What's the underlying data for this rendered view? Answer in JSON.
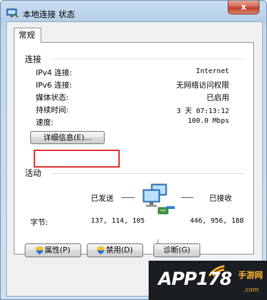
{
  "window": {
    "title": "本地连接 状态",
    "close_label": "x"
  },
  "tab": {
    "label": "常规"
  },
  "connection": {
    "heading": "连接",
    "rows": [
      {
        "label": "IPv4 连接:",
        "value": "Internet"
      },
      {
        "label": "IPv6 连接:",
        "value": "无网络访问权限"
      },
      {
        "label": "媒体状态:",
        "value": "已启用"
      },
      {
        "label": "持续时间:",
        "value": "3 天 07:13:12"
      },
      {
        "label": "速度:",
        "value": "100.0 Mbps"
      }
    ],
    "details_button": "详细信息(E)..."
  },
  "activity": {
    "heading": "活动",
    "sent_label": "已发送",
    "received_label": "已接收",
    "bytes_label": "字节:",
    "bytes_sent": "137, 114, 105",
    "bytes_received": "446, 956, 188"
  },
  "buttons": {
    "properties": "属性(P)",
    "disable": "禁用(D)",
    "diagnose": "诊断(G)"
  },
  "watermark": {
    "text": "APP178",
    "cn": "手游网",
    "com": ".com"
  },
  "colors": {
    "highlight": "#e02a2a",
    "titlebar": "#c9ddef",
    "close": "#c2402c"
  }
}
